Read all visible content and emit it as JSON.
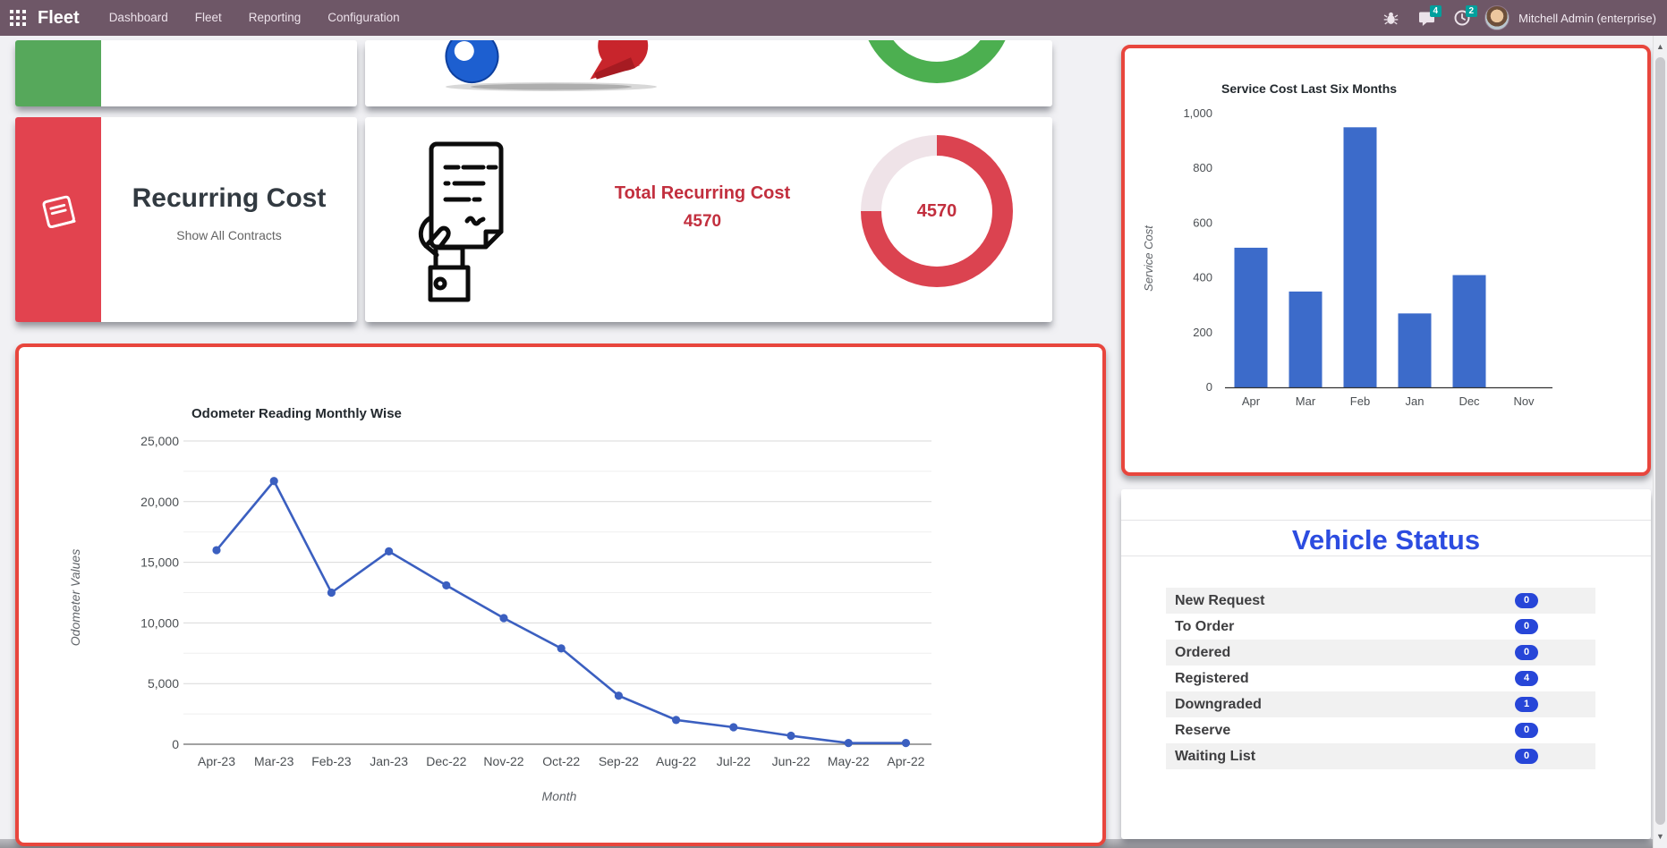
{
  "navbar": {
    "brand": "Fleet",
    "menu_items": [
      "Dashboard",
      "Fleet",
      "Reporting",
      "Configuration"
    ],
    "message_badge": "4",
    "activity_badge": "2",
    "user_name": "Mitchell Admin (enterprise)"
  },
  "icons": {
    "apps_menu": "grid-3x3",
    "debug": "bug",
    "messages": "speech-bubble",
    "activities": "clock",
    "user": "avatar-photo",
    "scroll_up": "▲",
    "scroll_down": "▼"
  },
  "colors": {
    "navbar_bg": "#6e5767",
    "page_bg": "#f1f1f4",
    "highlight_border": "#e8463d",
    "teal_badge": "#00a09d",
    "green_band": "#56a85b",
    "red_band": "#e2434f",
    "green_ring": "#4caf50",
    "line_blue": "#3b5fc0",
    "bar_blue": "#3c6bca",
    "vs_title_blue": "#2c4ce0",
    "vs_badge_blue": "#2746d8",
    "accent_red_text": "#c22f3e",
    "donut_red": "#db4350",
    "donut_track": "#efe3e8"
  },
  "cards": {
    "recurring_cost": {
      "title": "Recurring Cost",
      "subtitle": "Show All Contracts"
    },
    "total_recurring": {
      "title": "Total Recurring Cost",
      "value": "4570",
      "donut_label": "4570"
    }
  },
  "chart_data": [
    {
      "id": "odometer",
      "type": "line",
      "title": "Odometer Reading Monthly Wise",
      "xlabel": "Month",
      "ylabel": "Odometer Values",
      "categories": [
        "Apr-23",
        "Mar-23",
        "Feb-23",
        "Jan-23",
        "Dec-22",
        "Nov-22",
        "Oct-22",
        "Sep-22",
        "Aug-22",
        "Jul-22",
        "Jun-22",
        "May-22",
        "Apr-22"
      ],
      "values": [
        16000,
        21700,
        12500,
        15900,
        13100,
        10400,
        7900,
        4000,
        2000,
        1400,
        700,
        100,
        100
      ],
      "ylim": [
        0,
        25000
      ],
      "ytick_labels": [
        "25,000",
        "20,000",
        "15,000",
        "10,000",
        "5,000",
        "0"
      ],
      "grid": true,
      "legend": "none"
    },
    {
      "id": "service_cost",
      "type": "bar",
      "title": "Service Cost Last Six Months",
      "xlabel": "",
      "ylabel": "Service Cost",
      "categories": [
        "Apr",
        "Mar",
        "Feb",
        "Jan",
        "Dec",
        "Nov"
      ],
      "values": [
        510,
        350,
        950,
        270,
        410,
        0
      ],
      "ylim": [
        0,
        1000
      ],
      "ytick_labels": [
        "1,000",
        "800",
        "600",
        "400",
        "200",
        "0"
      ],
      "grid": false,
      "legend": "none"
    },
    {
      "id": "total_recurring_donut",
      "type": "pie",
      "categories": [
        "filled",
        "empty"
      ],
      "values": [
        75,
        25
      ],
      "center_label": "4570"
    }
  ],
  "vehicle_status": {
    "title": "Vehicle Status",
    "items": [
      {
        "label": "New Request",
        "count": "0"
      },
      {
        "label": "To Order",
        "count": "0"
      },
      {
        "label": "Ordered",
        "count": "0"
      },
      {
        "label": "Registered",
        "count": "4"
      },
      {
        "label": "Downgraded",
        "count": "1"
      },
      {
        "label": "Reserve",
        "count": "0"
      },
      {
        "label": "Waiting List",
        "count": "0"
      }
    ]
  }
}
